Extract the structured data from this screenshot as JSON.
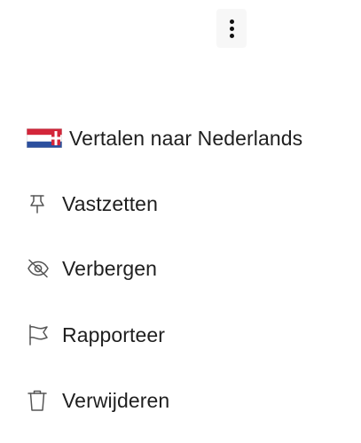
{
  "menu_button": {
    "icon": "more-vertical-icon"
  },
  "menu": {
    "items": [
      {
        "id": "translate",
        "label": "Vertalen naar Nederlands",
        "icon": "dutch-flag-icon"
      },
      {
        "id": "pin",
        "label": "Vastzetten",
        "icon": "pin-icon"
      },
      {
        "id": "hide",
        "label": "Verbergen",
        "icon": "eye-off-icon"
      },
      {
        "id": "report",
        "label": "Rapporteer",
        "icon": "flag-icon"
      },
      {
        "id": "delete",
        "label": "Verwijderen",
        "icon": "trash-icon"
      }
    ]
  },
  "colors": {
    "text": "#1f1f1f",
    "icon": "#555555",
    "flag_red": "#d3263a",
    "flag_white": "#ffffff",
    "flag_blue": "#2b4f9e",
    "kebab_bg": "#f7f7f7"
  }
}
